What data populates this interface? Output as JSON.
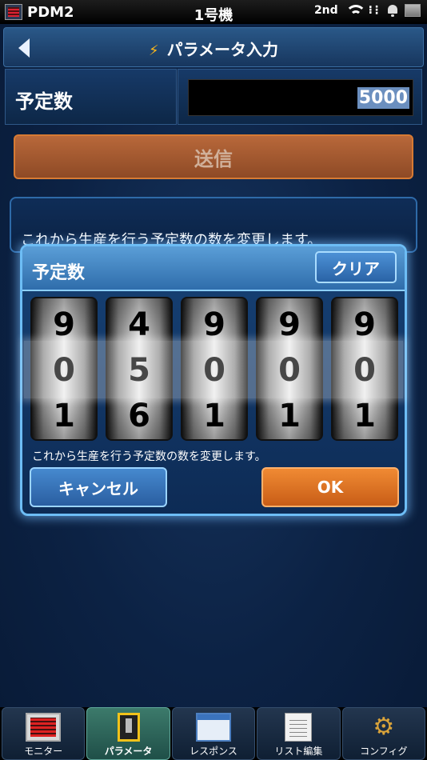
{
  "statusbar": {
    "app_name": "PDM2",
    "machine": "1号機",
    "network": "2nd"
  },
  "header": {
    "title": "パラメータ入力"
  },
  "form": {
    "label": "予定数",
    "value": "5000"
  },
  "send_button": "送信",
  "info_message": "これから生産を行う予定数の数を変更します。",
  "dialog": {
    "title": "予定数",
    "clear_label": "クリア",
    "drums": [
      {
        "above": "9",
        "selected": "0",
        "below": "1"
      },
      {
        "above": "4",
        "selected": "5",
        "below": "6"
      },
      {
        "above": "9",
        "selected": "0",
        "below": "1"
      },
      {
        "above": "9",
        "selected": "0",
        "below": "1"
      },
      {
        "above": "9",
        "selected": "0",
        "below": "1"
      }
    ],
    "message": "これから生産を行う予定数の数を変更します。",
    "cancel_label": "キャンセル",
    "ok_label": "OK"
  },
  "tabs": [
    {
      "label": "モニター",
      "icon": "monitor-icon",
      "active": false
    },
    {
      "label": "パラメータ",
      "icon": "parameter-icon",
      "active": true
    },
    {
      "label": "レスポンス",
      "icon": "response-icon",
      "active": false
    },
    {
      "label": "リスト編集",
      "icon": "list-edit-icon",
      "active": false
    },
    {
      "label": "コンフィグ",
      "icon": "config-icon",
      "active": false
    }
  ],
  "colors": {
    "accent_orange": "#e07a2e",
    "dialog_border": "#6dbdf5",
    "active_tab": "#3c7a6b"
  }
}
